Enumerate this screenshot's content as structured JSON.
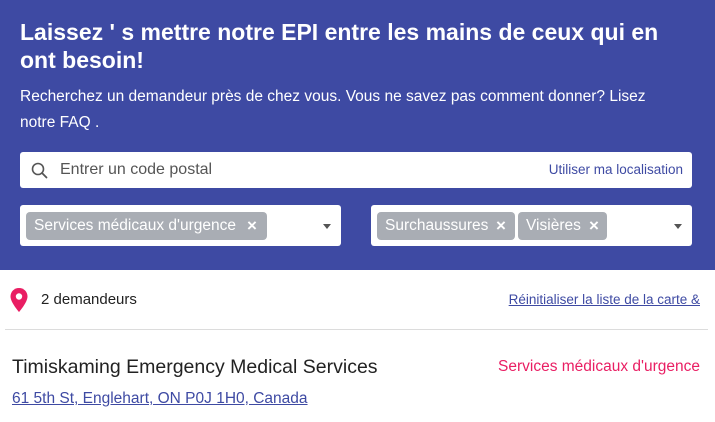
{
  "hero": {
    "title": "Laissez ' s mettre notre EPI entre les mains de ceux qui en ont besoin!",
    "subtitle_text": "Recherchez un demandeur près de chez vous. Vous ne savez pas comment donner? Lisez notre ",
    "faq_label": "FAQ",
    "subtitle_end": " ."
  },
  "search": {
    "placeholder": "Entrer un code postal",
    "value": "",
    "use_location_label": "Utiliser ma localisation",
    "icon": "search-icon"
  },
  "filters": {
    "category_chips": [
      {
        "label": "Services médicaux d'urgence",
        "remove": "×"
      }
    ],
    "item_chips": [
      {
        "label": "Surchaussures",
        "remove": "×"
      },
      {
        "label": "Visières",
        "remove": "×"
      }
    ]
  },
  "results": {
    "pin_icon": "map-pin-icon",
    "count_label": "2 demandeurs",
    "reset_label": "Réinitialiser la liste de la carte &"
  },
  "requesters": [
    {
      "name": "Timiskaming Emergency Medical Services",
      "category": "Services médicaux d'urgence",
      "address": "61 5th St, Englehart, ON P0J 1H0, Canada"
    }
  ],
  "colors": {
    "hero_bg": "#3e4aa3",
    "link": "#3e4aa3",
    "accent": "#e91e63",
    "chip_bg": "#a9adb4"
  }
}
